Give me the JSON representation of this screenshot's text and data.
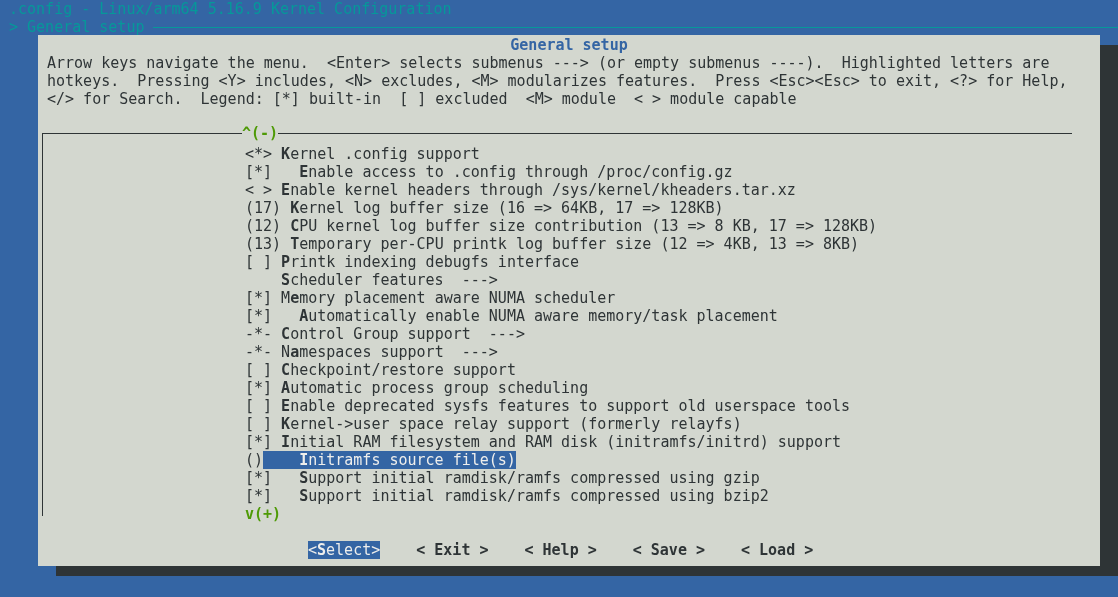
{
  "window": {
    "title": ".config - Linux/arm64 5.16.9 Kernel Configuration"
  },
  "breadcrumb": "> General setup",
  "dialog": {
    "title": "General setup",
    "help": [
      "Arrow keys navigate the menu.  <Enter> selects submenus ---> (or empty submenus ----).  Highlighted letters are",
      "hotkeys.  Pressing <Y> includes, <N> excludes, <M> modularizes features.  Press <Esc><Esc> to exit, <?> for Help,",
      "</> for Search.  Legend: [*] built-in  [ ] excluded  <M> module  < > module capable"
    ],
    "scroll_up": "^(-)",
    "items": [
      {
        "prefix": "<*>",
        "label": "**K**ernel .config support",
        "selected": false,
        "children": [
          {
            "prefix": "[*]",
            "label": "**E**nable access to .config through /proc/config.gz",
            "selected": false
          }
        ]
      },
      {
        "prefix": "< >",
        "label": "**E**nable kernel headers through /sys/kernel/kheaders.tar.xz",
        "selected": false
      },
      {
        "prefix": "(17)",
        "label": "**K**ernel log buffer size (16 => 64KB, 17 => 128KB)",
        "selected": false
      },
      {
        "prefix": "(12)",
        "label": "**C**PU kernel log buffer size contribution (13 => 8 KB, 17 => 128KB)",
        "selected": false
      },
      {
        "prefix": "(13)",
        "label": "**T**emporary per-CPU printk log buffer size (12 => 4KB, 13 => 8KB)",
        "selected": false
      },
      {
        "prefix": "[ ]",
        "label": "**P**rintk indexing debugfs interface",
        "selected": false
      },
      {
        "label": "**S**cheduler features  --->",
        "selected": false
      },
      {
        "prefix": "[*]",
        "label": "M**e**mory placement aware NUMA scheduler",
        "selected": false,
        "children": [
          {
            "prefix": "[*]",
            "label": "**A**utomatically enable NUMA aware memory/task placement",
            "selected": false
          }
        ]
      },
      {
        "prefix": "-*-",
        "label": "**C**ontrol Group support  --->",
        "selected": false
      },
      {
        "prefix": "-*-",
        "label": "N**a**mespaces support  --->",
        "selected": false
      },
      {
        "prefix": "[ ]",
        "label": "**C**heckpoint/restore support",
        "selected": false
      },
      {
        "prefix": "[*]",
        "label": "**A**utomatic process group scheduling",
        "selected": false
      },
      {
        "prefix": "[ ]",
        "label": "**E**nable deprecated sysfs features to support old userspace tools",
        "selected": false
      },
      {
        "prefix": "[ ]",
        "label": "**K**ernel->user space relay support (formerly relayfs)",
        "selected": false
      },
      {
        "prefix": "[*]",
        "label": "**I**nitial RAM filesystem and RAM disk (initramfs/initrd) support",
        "selected": false,
        "children": [
          {
            "prefix": "()",
            "label": "**I**nitramfs source file(s)",
            "selected": true
          },
          {
            "prefix": "[*]",
            "label": "**S**upport initial ramdisk/ramfs compressed using gzip",
            "selected": false
          },
          {
            "prefix": "[*]",
            "label": "**S**upport initial ramdisk/ramfs compressed using bzip2",
            "selected": false
          }
        ]
      }
    ],
    "scroll_down": "v(+)",
    "buttons": [
      {
        "label": "<**S**elect>",
        "selected": true
      },
      {
        "label": "< **E**xit >",
        "selected": false
      },
      {
        "label": "< **H**elp >",
        "selected": false
      },
      {
        "label": "< **S**ave >",
        "selected": false
      },
      {
        "label": "< **L**oad >",
        "selected": false
      }
    ]
  }
}
